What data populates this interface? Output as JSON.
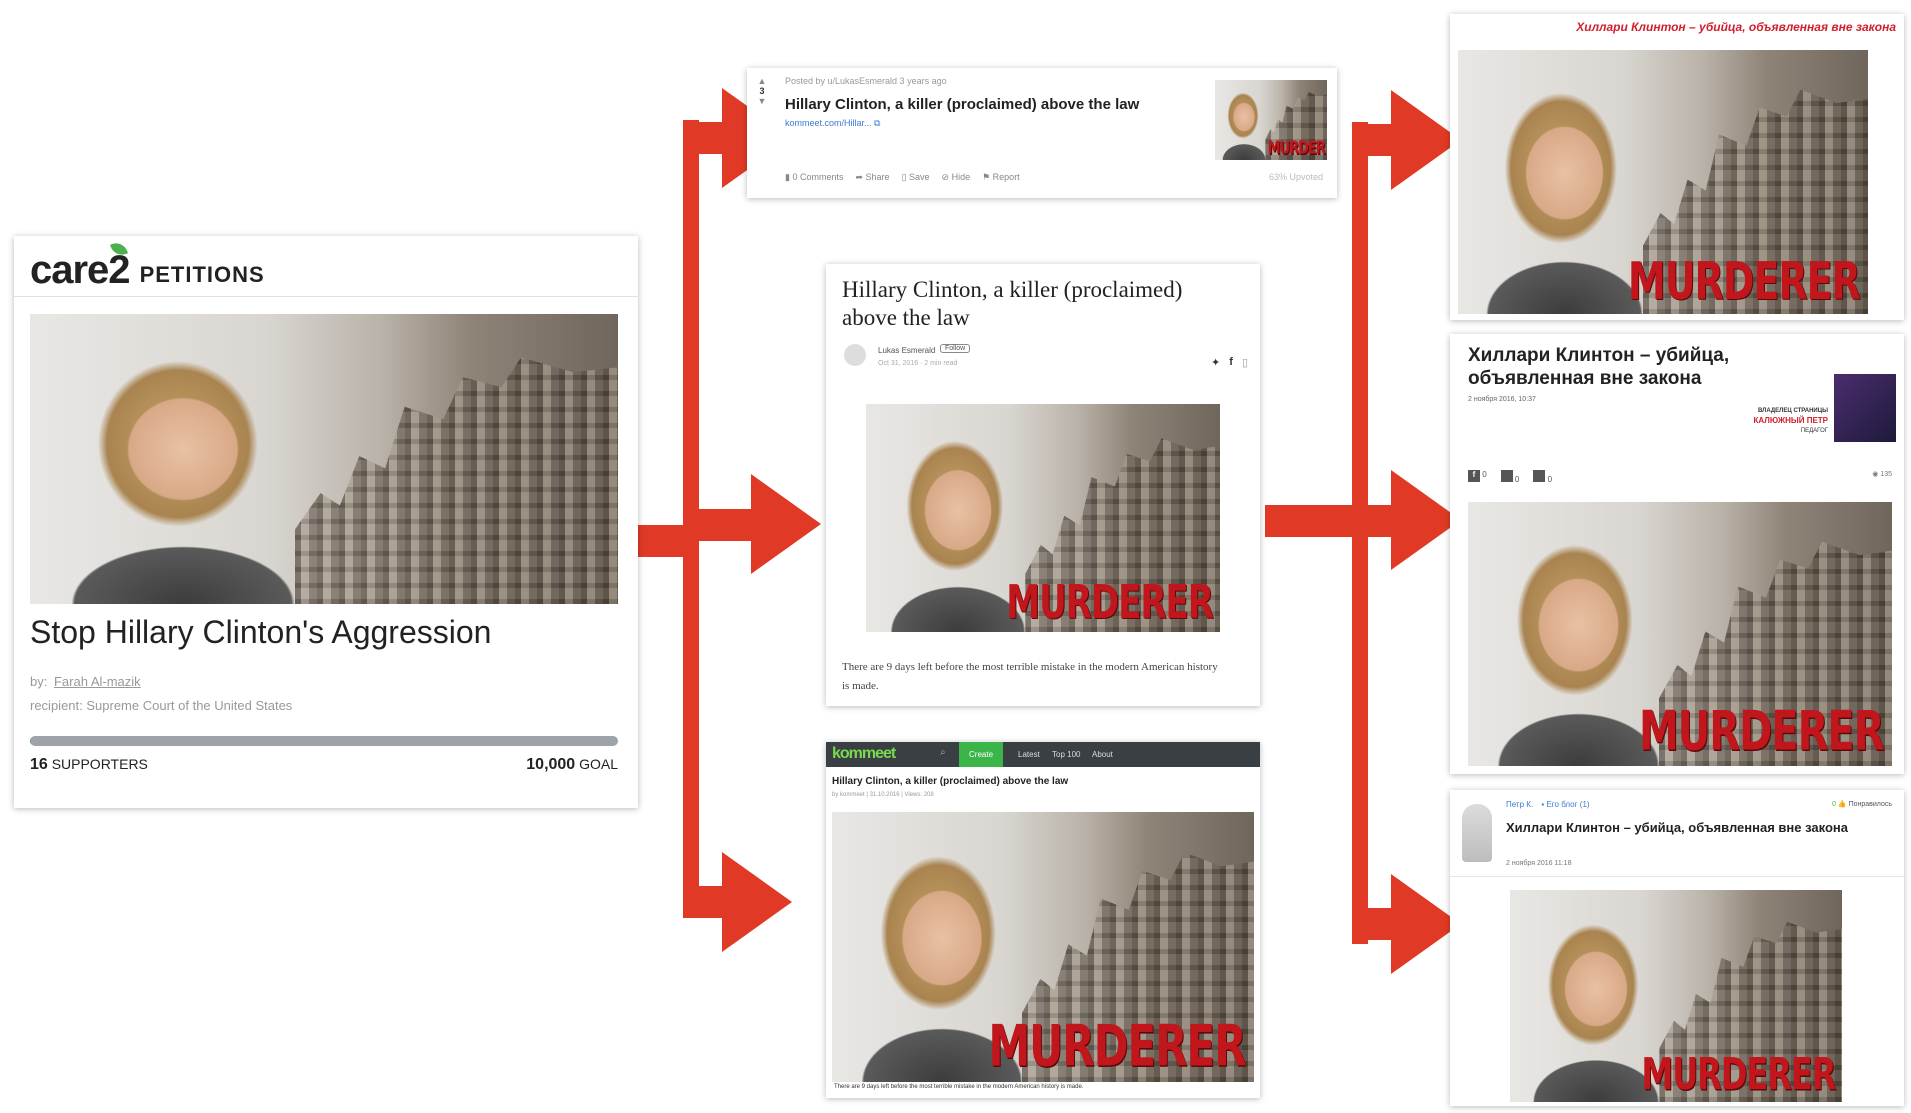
{
  "petition": {
    "brand": "care2",
    "section": "PETITIONS",
    "image_overlay": "",
    "title": "Stop Hillary Clinton's Aggression",
    "by_label": "by:",
    "author": "Farah Al-mazik",
    "recipient": "recipient: Supreme Court of the United States",
    "supporters_count": "16",
    "supporters_label": "SUPPORTERS",
    "goal_count": "10,000",
    "goal_label": "GOAL",
    "progress_fraction": 0.0016
  },
  "reddit": {
    "vote_count": "3",
    "posted_by": "Posted by u/LukasEsmerald 3 years ago",
    "title": "Hillary Clinton, a killer (proclaimed) above the law",
    "link": "kommeet.com/Hillar...",
    "thumb_label": "MURDER",
    "actions": [
      "0 Comments",
      "Share",
      "Save",
      "Hide",
      "Report"
    ],
    "upvoted": "63% Upvoted"
  },
  "medium": {
    "title": "Hillary Clinton, a killer (proclaimed) above the law",
    "author": "Lukas Esmerald",
    "follow": "Follow",
    "meta": "Oct 31, 2016 · 2 min read",
    "image_label": "MURDERER",
    "body": "There are 9 days left before the most terrible mistake in the modern American history is made."
  },
  "kommeet": {
    "logo": "kommeet",
    "nav": [
      "Create",
      "Latest",
      "Top 100",
      "About"
    ],
    "title": "Hillary Clinton, a killer (proclaimed) above the law",
    "meta": "by kommeet | 31.10.2016 | Views: 208",
    "image_label": "MURDERER",
    "caption": "There are 9 days left before the most terrible mistake in the modern American history is made."
  },
  "ru_top": {
    "header": "Хиллари Клинтон – убийца, объявленная вне закона",
    "image_label": "MURDERER"
  },
  "ru_mid": {
    "title": "Хиллари Клинтон – убийца, объявленная вне закона",
    "date": "2 ноября 2016, 10:37",
    "owner_label": "ВЛАДЕЛЕЦ СТРАНИЦЫ",
    "owner_name": "КАЛЮЖНЫЙ ПЕТР",
    "owner_role": "ПЕДАГОГ",
    "share_counts": [
      "0",
      "0",
      "0"
    ],
    "views": "135",
    "image_label": "MURDERER"
  },
  "ru_bottom": {
    "author": "Петр К.",
    "blog": "Его блог (1)",
    "likes": "0",
    "like_label": "Понравилось",
    "title": "Хиллари Клинтон – убийца, объявленная вне закона",
    "date": "2 ноября 2016 11:18",
    "image_label": "MURDERER"
  },
  "colors": {
    "arrow": "#e03a26",
    "murder": "#c1161c",
    "care2_green": "#4db04a",
    "kommeet_bar": "#3a3f44",
    "kommeet_create": "#3bb54a",
    "ru_header": "#d0202e",
    "link": "#3a7bd5"
  }
}
